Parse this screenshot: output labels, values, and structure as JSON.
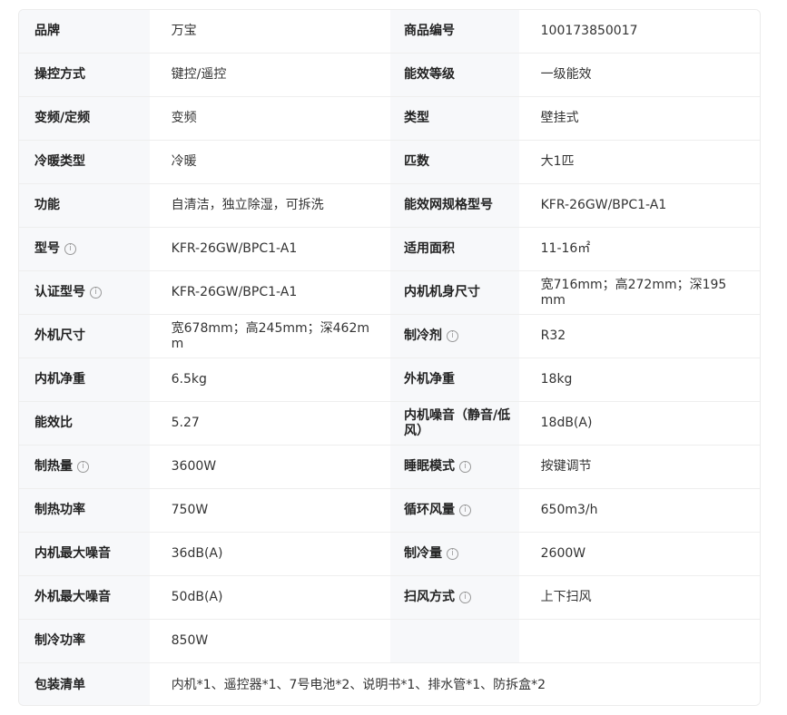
{
  "specs": {
    "rows": [
      {
        "l1": "品牌",
        "v1": "万宝",
        "l2": "商品编号",
        "v2": "100173850017"
      },
      {
        "l1": "操控方式",
        "v1": "键控/遥控",
        "l2": "能效等级",
        "v2": "一级能效"
      },
      {
        "l1": "变频/定频",
        "v1": "变频",
        "l2": "类型",
        "v2": "壁挂式"
      },
      {
        "l1": "冷暖类型",
        "v1": "冷暖",
        "l2": "匹数",
        "v2": "大1匹"
      },
      {
        "l1": "功能",
        "v1": "自清洁，独立除湿，可拆洗",
        "l2": "能效网规格型号",
        "v2": "KFR-26GW/BPC1-A1"
      },
      {
        "l1": "型号",
        "v1": "KFR-26GW/BPC1-A1",
        "l2": "适用面积",
        "v2": "11-16㎡"
      },
      {
        "l1": "认证型号",
        "v1": "KFR-26GW/BPC1-A1",
        "l2": "内机机身尺寸",
        "v2": "宽716mm；高272mm；深195mm"
      },
      {
        "l1": "外机尺寸",
        "v1": "宽678mm；高245mm；深462mm",
        "l2": "制冷剂",
        "v2": "R32"
      },
      {
        "l1": "内机净重",
        "v1": "6.5kg",
        "l2": "外机净重",
        "v2": "18kg"
      },
      {
        "l1": "能效比",
        "v1": "5.27",
        "l2": "内机噪音（静音/低风）",
        "v2": "18dB(A)"
      },
      {
        "l1": "制热量",
        "v1": "3600W",
        "l2": "睡眠模式",
        "v2": "按键调节"
      },
      {
        "l1": "制热功率",
        "v1": "750W",
        "l2": "循环风量",
        "v2": "650m3/h"
      },
      {
        "l1": "内机最大噪音",
        "v1": "36dB(A)",
        "l2": "制冷量",
        "v2": "2600W"
      },
      {
        "l1": "外机最大噪音",
        "v1": "50dB(A)",
        "l2": "扫风方式",
        "v2": "上下扫风"
      },
      {
        "l1": "制冷功率",
        "v1": "850W"
      },
      {
        "l1": "包装清单",
        "v1": "内机*1、遥控器*1、7号电池*2、说明书*1、排水管*1、防拆盒*2"
      }
    ]
  },
  "icons": {
    "info_glyph": "i"
  }
}
